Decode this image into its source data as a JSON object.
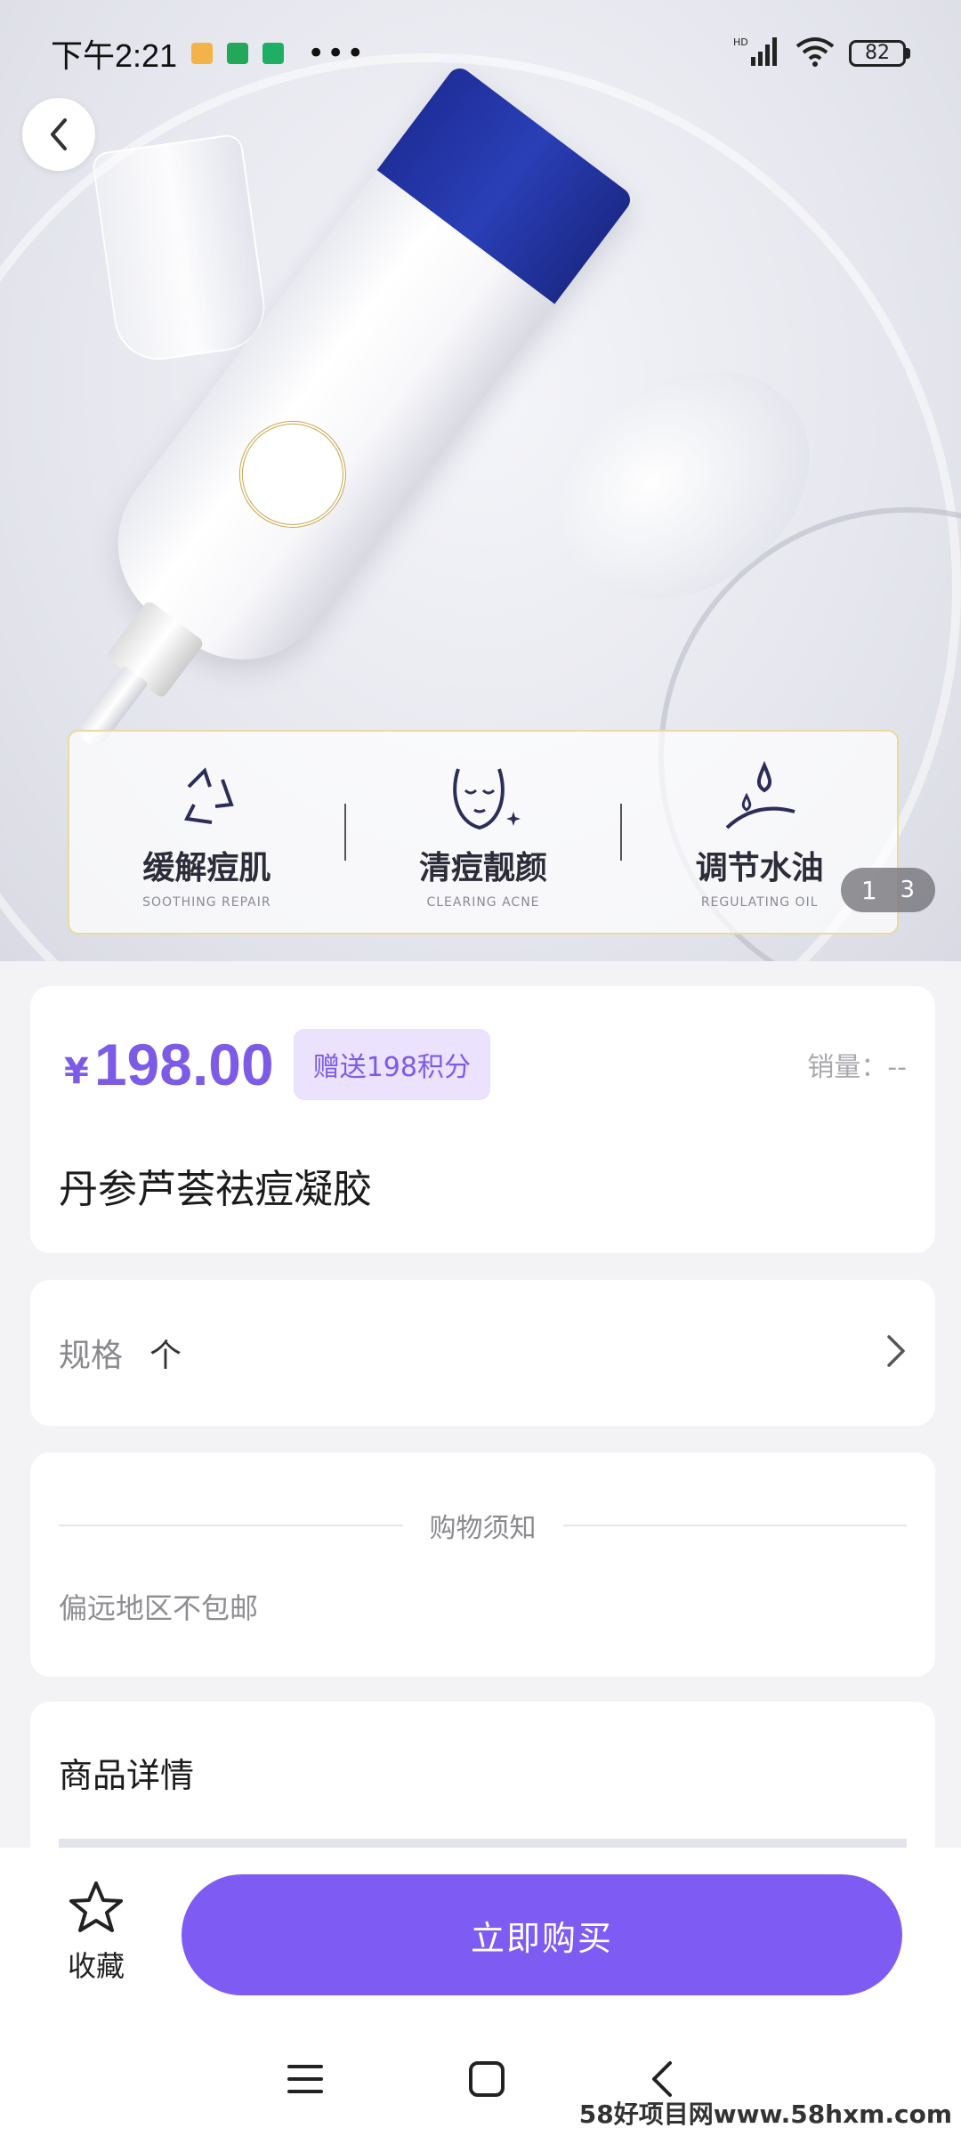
{
  "status_bar": {
    "time": "下午2:21",
    "battery": "82",
    "network": "HD"
  },
  "hero": {
    "features": [
      {
        "title": "缓解痘肌",
        "subtitle": "SOOTHING REPAIR",
        "icon": "recycle-arrows-icon"
      },
      {
        "title": "清痘靓颜",
        "subtitle": "CLEARING ACNE",
        "icon": "face-sparkle-icon"
      },
      {
        "title": "调节水油",
        "subtitle": "REGULATING OIL",
        "icon": "water-drops-icon"
      }
    ],
    "pager": {
      "current": "1",
      "total": "3"
    }
  },
  "product": {
    "currency": "¥",
    "price": "198.00",
    "gift_points": "赠送198积分",
    "sales": "销量：--",
    "title": "丹参芦荟祛痘凝胶"
  },
  "spec": {
    "label": "规格",
    "value": "个"
  },
  "notice": {
    "title": "购物须知",
    "text": "偏远地区不包邮"
  },
  "detail": {
    "title": "商品详情"
  },
  "bottom_bar": {
    "favorite_label": "收藏",
    "buy_label": "立即购买"
  },
  "watermark": "58好项目网www.58hxm.com",
  "colors": {
    "accent": "#7e5cf3",
    "gift_bg": "#ebe2fd",
    "tube_cap": "#1f2f9a"
  }
}
